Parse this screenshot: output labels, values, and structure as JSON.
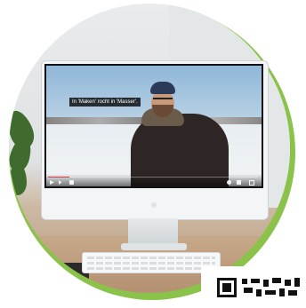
{
  "video": {
    "subtitle": "In 'Maken' rocht in 'Masser'.",
    "progress_fraction": 0.1
  },
  "icons": {
    "play": "play-icon",
    "next": "next-icon",
    "volume": "volume-icon",
    "settings": "gear-icon",
    "fullscreen": "fullscreen-icon",
    "qr": "qr-code-icon"
  },
  "colors": {
    "accent_ring": "#8bc34a",
    "progress": "#e53935"
  }
}
